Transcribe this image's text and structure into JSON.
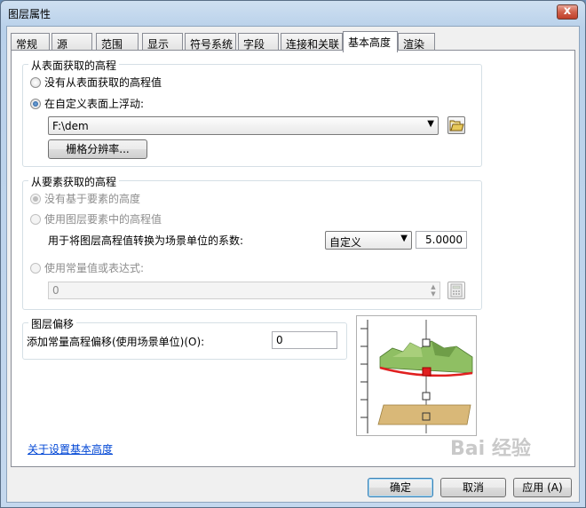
{
  "window": {
    "title": "图层属性",
    "close_glyph": "x"
  },
  "tabs": [
    {
      "label": "常规",
      "active": false
    },
    {
      "label": "源",
      "active": false
    },
    {
      "label": "范围",
      "active": false
    },
    {
      "label": "显示",
      "active": false
    },
    {
      "label": "符号系统",
      "active": false
    },
    {
      "label": "字段",
      "active": false
    },
    {
      "label": "连接和关联",
      "active": false
    },
    {
      "label": "基本高度",
      "active": true
    },
    {
      "label": "渲染",
      "active": false
    }
  ],
  "surface_group": {
    "title": "从表面获取的高程",
    "options": [
      {
        "label": "没有从表面获取的高程值",
        "checked": false
      },
      {
        "label": "在自定义表面上浮动:",
        "checked": true
      }
    ],
    "surface_value": "F:\\dem",
    "raster_button": "栅格分辨率..."
  },
  "feature_group": {
    "title": "从要素获取的高程",
    "options": [
      {
        "label": "没有基于要素的高度",
        "checked": true
      },
      {
        "label": "使用图层要素中的高程值",
        "checked": false
      },
      {
        "label": "使用常量值或表达式:",
        "checked": false
      }
    ],
    "factor_label": "用于将图层高程值转换为场景单位的系数:",
    "unit_select": "自定义",
    "factor_value": "5.0000",
    "expression_value": "0"
  },
  "offset_group": {
    "title": "图层偏移",
    "offset_label": "添加常量高程偏移(使用场景单位)(O):",
    "offset_value": "0"
  },
  "help_link": "关于设置基本高度",
  "buttons": {
    "ok": "确定",
    "cancel": "取消",
    "apply": "应用 (A)"
  },
  "watermark": "Bai 经验",
  "colors": {
    "accent": "#3c7fb1",
    "surface_green": "#7fae5a",
    "base_plane": "#d9b878",
    "marker_red": "#e02020"
  }
}
